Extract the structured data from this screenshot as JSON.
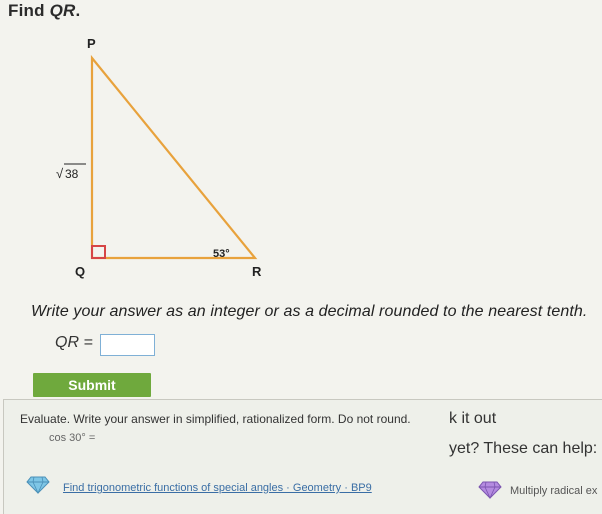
{
  "question": {
    "prefix": "Find ",
    "var": "QR",
    "suffix": "."
  },
  "figure": {
    "vertex_p": "P",
    "vertex_q": "Q",
    "vertex_r": "R",
    "side_pq": "38",
    "angle_r": "53°",
    "stroke_color": "#e8a23c",
    "right_angle_color": "#d64545"
  },
  "instructions": "Write your answer as an integer or as a decimal rounded to the nearest tenth.",
  "answer": {
    "label": "QR =",
    "value": "",
    "placeholder": ""
  },
  "submit": {
    "label": "Submit",
    "color": "#6fa93d"
  },
  "hint": {
    "prompt": "Evaluate. Write your answer in simplified, rationalized form. Do not round.",
    "expression": "cos 30° =",
    "help_partial": "k it out",
    "help_prompt": "yet? These can help:",
    "links": [
      {
        "label": "Find trigonometric functions of special angles · Geometry · BP9"
      },
      {
        "label": "Multiply radical ex"
      }
    ]
  }
}
